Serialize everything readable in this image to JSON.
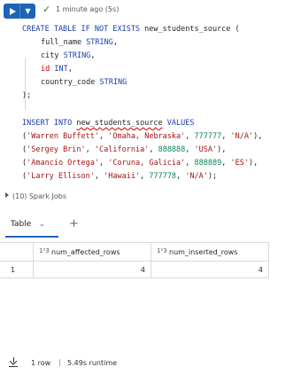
{
  "run": {
    "status_text": "1 minute ago (5s)",
    "check_icon": "check-icon",
    "run_icon": "play-icon",
    "menu_icon": "chevron-down-icon"
  },
  "code": {
    "lines": [
      "CREATE TABLE IF NOT EXISTS new_students_source (",
      "full_name STRING,",
      "city STRING,",
      "id INT,",
      "country_code STRING",
      ");",
      "",
      "INSERT INTO new_students_source VALUES",
      "('Warren Buffett', 'Omaha, Nebraska', 777777, 'N/A'),",
      "('Sergey Brin', 'California', 888888, 'USA'),",
      "('Amancio Ortega', 'Coruna, Galicia', 888889, 'ES'),",
      "('Larry Ellison', 'Hawaii', 777778, 'N/A');"
    ]
  },
  "jobs": {
    "label": "(10) Spark Jobs"
  },
  "tabs": {
    "active": "Table",
    "add": "+"
  },
  "table": {
    "columns": [
      {
        "type": "1²3",
        "name": "num_affected_rows"
      },
      {
        "type": "1²3",
        "name": "num_inserted_rows"
      }
    ],
    "rows": [
      {
        "index": "1",
        "values": [
          "4",
          "4"
        ]
      }
    ]
  },
  "footer": {
    "rows": "1 row",
    "separator": "|",
    "runtime": "5.49s runtime"
  },
  "colors": {
    "accent": "#1d63b8",
    "success": "#2e7d32",
    "keyword": "#1a3ea8",
    "string": "#a31515",
    "number": "#098658"
  }
}
